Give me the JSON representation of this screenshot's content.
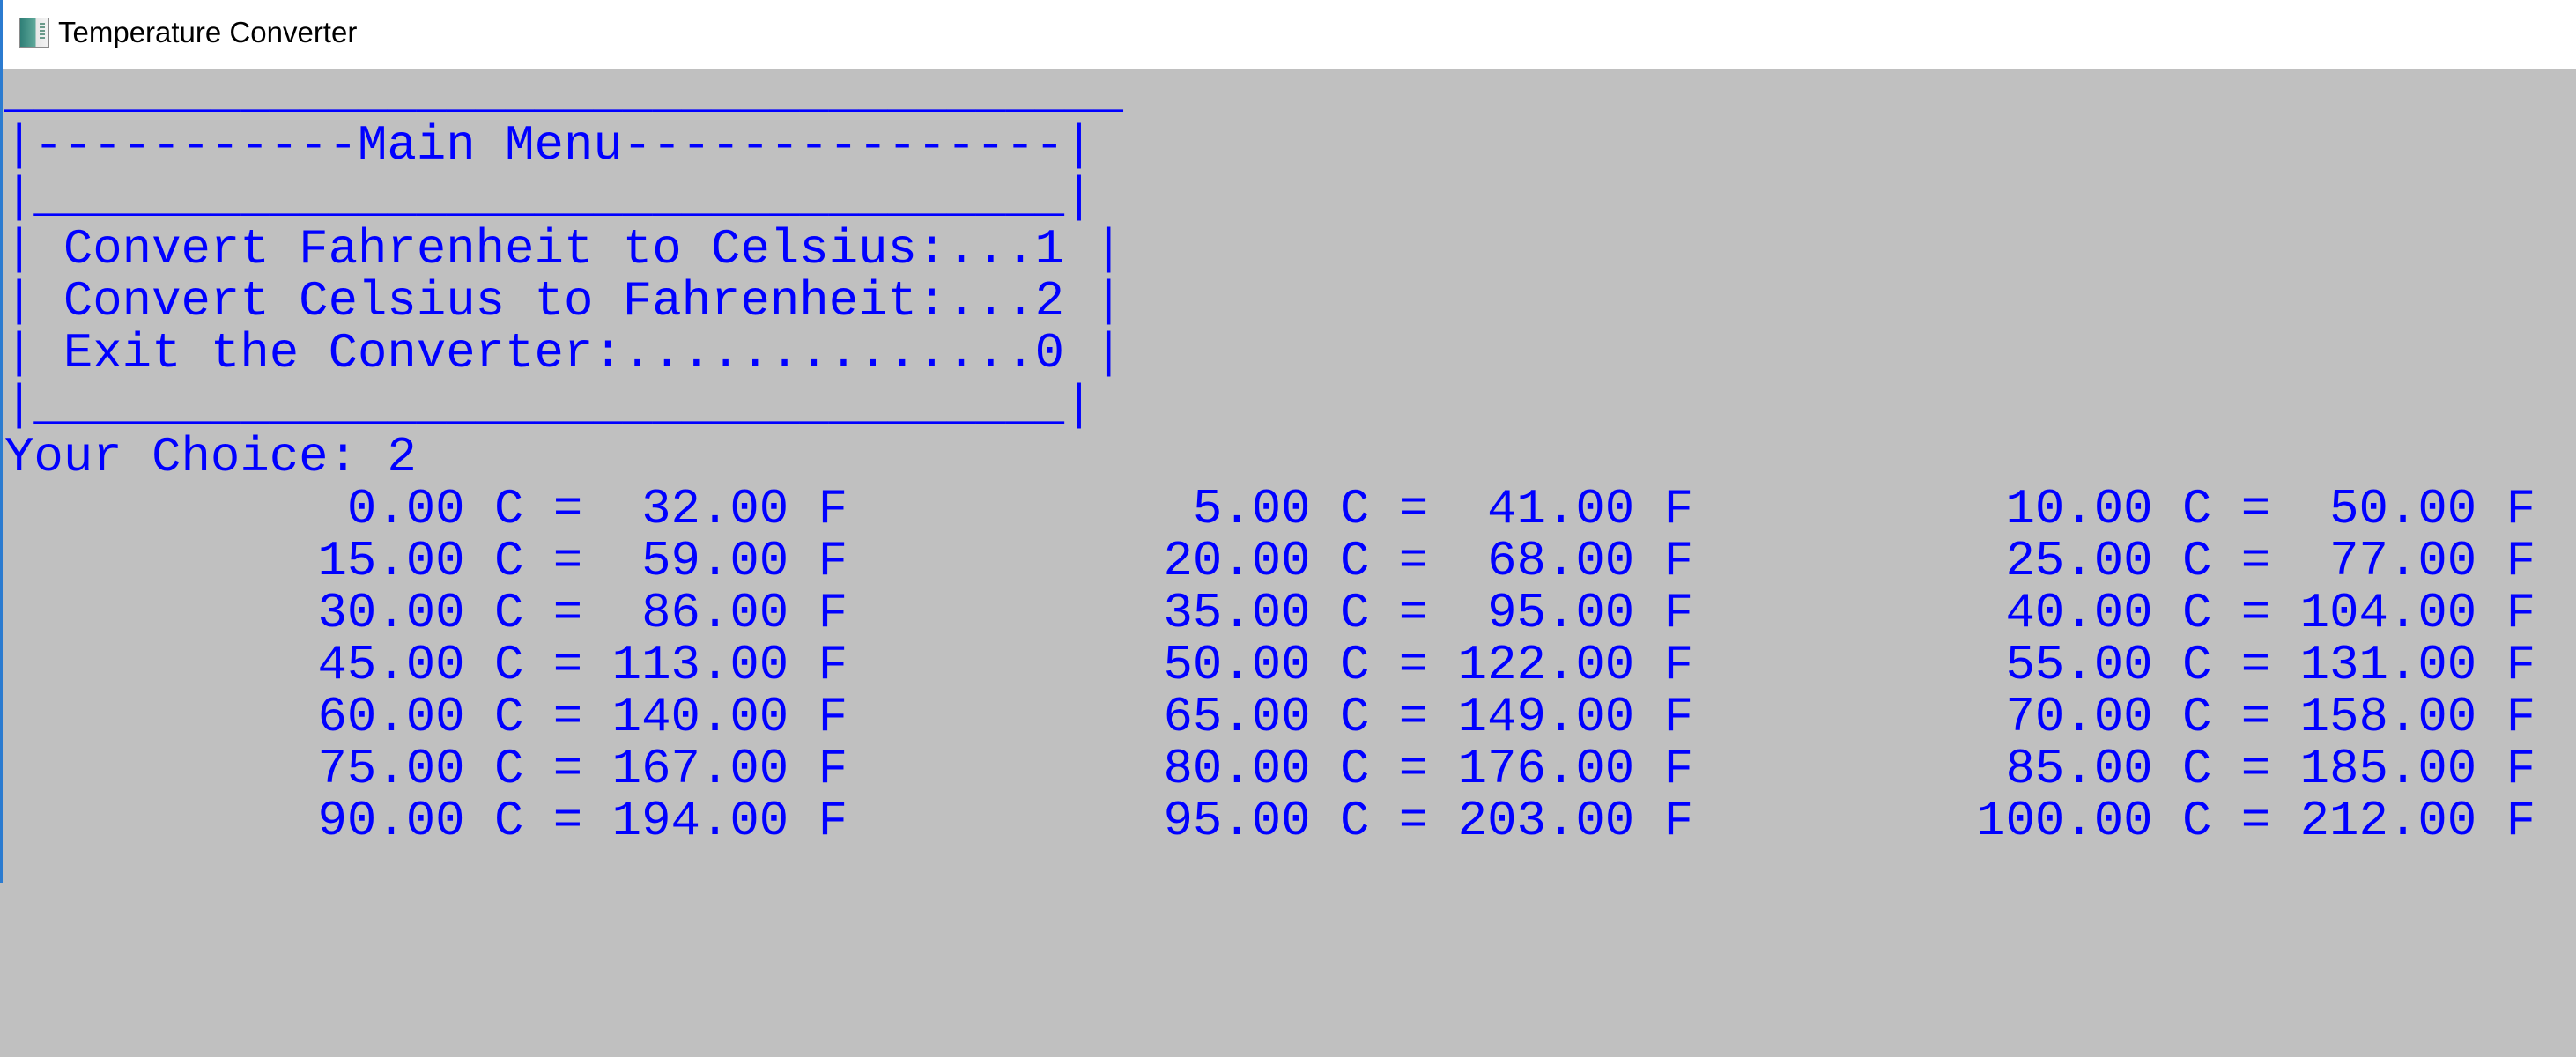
{
  "window": {
    "title": "Temperature Converter",
    "icon": "app-window-icon"
  },
  "menu": {
    "lines": [
      "______________________________________",
      "|-----------Main Menu---------------|",
      "|___________________________________|",
      "| Convert Fahrenheit to Celsius:...1 |",
      "| Convert Celsius to Fahrenheit:...2 |",
      "| Exit the Converter:..............0 |",
      "|___________________________________|"
    ]
  },
  "prompt": "Your Choice: 2",
  "table": {
    "rows": [
      [
        "0.00 C =  32.00 F",
        "5.00 C =  41.00 F",
        "10.00 C =  50.00 F"
      ],
      [
        "15.00 C =  59.00 F",
        "20.00 C =  68.00 F",
        "25.00 C =  77.00 F"
      ],
      [
        "30.00 C =  86.00 F",
        "35.00 C =  95.00 F",
        "40.00 C = 104.00 F"
      ],
      [
        "45.00 C = 113.00 F",
        "50.00 C = 122.00 F",
        "55.00 C = 131.00 F"
      ],
      [
        "60.00 C = 140.00 F",
        "65.00 C = 149.00 F",
        "70.00 C = 158.00 F"
      ],
      [
        "75.00 C = 167.00 F",
        "80.00 C = 176.00 F",
        "85.00 C = 185.00 F"
      ],
      [
        "90.00 C = 194.00 F",
        "95.00 C = 203.00 F",
        "100.00 C = 212.00 F"
      ]
    ]
  },
  "colors": {
    "background": "#c0c0c0",
    "text": "#0000ff",
    "titlebar": "#ffffff",
    "accent": "#2b7bd0"
  }
}
